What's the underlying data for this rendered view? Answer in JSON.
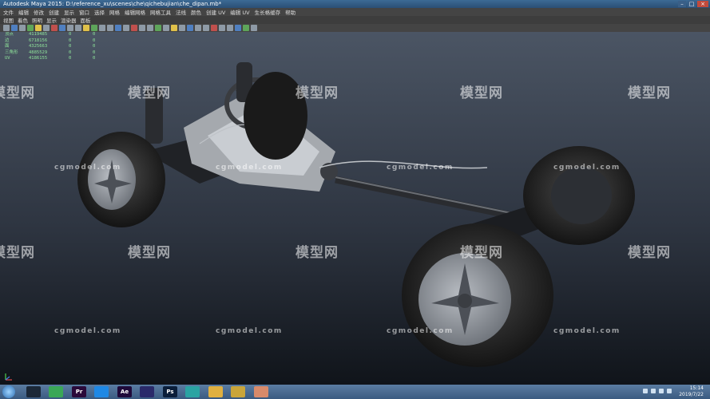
{
  "window": {
    "title": "Autodesk Maya 2015: D:\\reference_xu\\scenes\\che\\qichebujian\\che_dipan.mb*"
  },
  "menu": [
    "文件",
    "编辑",
    "修改",
    "创建",
    "显示",
    "窗口",
    "选择",
    "网格",
    "编辑网格",
    "网格工具",
    "法线",
    "颜色",
    "创建 UV",
    "编辑 UV",
    "生长格缓存",
    "帮助"
  ],
  "panel_menu": [
    "视图",
    "着色",
    "照明",
    "显示",
    "渲染器",
    "面板"
  ],
  "hud": [
    {
      "label": "顶点",
      "value": "4119485",
      "c1": "0",
      "c2": "0"
    },
    {
      "label": "边",
      "value": "6718156",
      "c1": "0",
      "c2": "0"
    },
    {
      "label": "面",
      "value": "4325663",
      "c1": "0",
      "c2": "0"
    },
    {
      "label": "三角形",
      "value": "4885529",
      "c1": "0",
      "c2": "0"
    },
    {
      "label": "UV",
      "value": "4186155",
      "c1": "0",
      "c2": "0"
    }
  ],
  "watermark": {
    "brand": "模型网",
    "url": "cgmodel.com"
  },
  "taskbar": {
    "apps": [
      {
        "name": "steam",
        "label": "",
        "color": "#1b2838"
      },
      {
        "name": "chrome",
        "label": "",
        "color": "#3aa757"
      },
      {
        "name": "premiere",
        "label": "Pr",
        "color": "#2a0a3a"
      },
      {
        "name": "qq",
        "label": "",
        "color": "#1e88e5"
      },
      {
        "name": "after-effects",
        "label": "Ae",
        "color": "#1f0a3a"
      },
      {
        "name": "media-encoder",
        "label": "",
        "color": "#2a2a6a"
      },
      {
        "name": "photoshop",
        "label": "Ps",
        "color": "#0a1e3a"
      },
      {
        "name": "maya",
        "label": "",
        "color": "#2aa3a3"
      },
      {
        "name": "explorer",
        "label": "",
        "color": "#e0b040"
      },
      {
        "name": "foobar",
        "label": "",
        "color": "#c9a53a"
      },
      {
        "name": "user-app",
        "label": "",
        "color": "#d88a6a"
      }
    ],
    "time": "15:14",
    "date": "2019/7/22"
  }
}
